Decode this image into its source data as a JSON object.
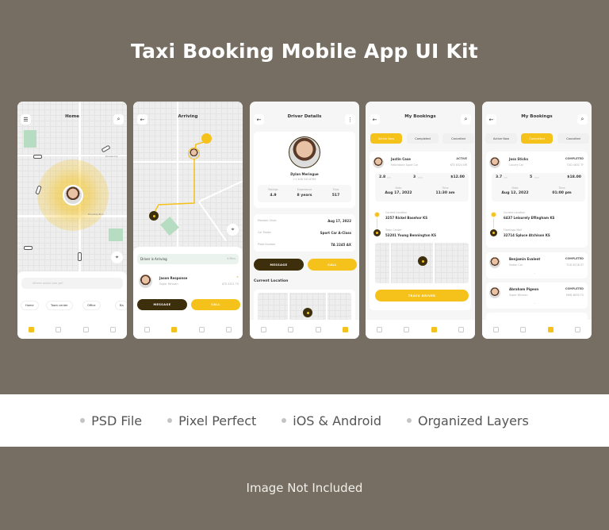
{
  "title": "Taxi Booking Mobile App UI Kit",
  "features": [
    "PSD File",
    "Pixel Perfect",
    "iOS & Android",
    "Organized Layers"
  ],
  "note": "Image Not Included",
  "colors": {
    "background": "#766e63",
    "accent": "#f5c21b",
    "dark": "#3d2e0c"
  },
  "home": {
    "title": "Home",
    "search_placeholder": "Where would you go?",
    "chips": [
      "Home",
      "Town center",
      "Office",
      "Ba"
    ],
    "street1": "Excellent Dr",
    "street2": "Broadway Blvd",
    "nav_active": 0
  },
  "arriving": {
    "title": "Arriving",
    "status": "Driver is Arriving",
    "eta": "4 Mins",
    "driver": {
      "name": "Jason Response",
      "car": "Super Minivan",
      "plate": "ATX 4321 TX"
    },
    "message": "MESSAGE",
    "call": "CALL",
    "nav_active": 1
  },
  "driver": {
    "title": "Driver Details",
    "name": "Dylan Meringue",
    "phone": "+1 408 345 6789",
    "stats": [
      {
        "label": "Ratings",
        "value": "4.9"
      },
      {
        "label": "Experience",
        "value": "8 years"
      },
      {
        "label": "Trips",
        "value": "517"
      }
    ],
    "info": [
      {
        "label": "Member Since",
        "value": "Aug 17, 2022"
      },
      {
        "label": "Car Model",
        "value": "Sport Car A-Class"
      },
      {
        "label": "Plate Number",
        "value": "TA 2245 AX"
      }
    ],
    "message": "MESSAGE",
    "call": "CALL",
    "location_title": "Current Location",
    "nav_active": 3
  },
  "bookings_active": {
    "title": "My Bookings",
    "tabs": [
      "Active Now",
      "Completed",
      "Cancelled"
    ],
    "active_tab": 0,
    "booking": {
      "name": "Justin Case",
      "car": "Hatchback Sport Car",
      "status": "ACTIVE",
      "plate": "KTE 8324 NR",
      "distance": "2.8",
      "distance_unit": "km",
      "duration": "3",
      "duration_unit": "min",
      "price": "$12.00",
      "date_label": "Date",
      "date": "Aug 17, 2022",
      "time_label": "Time",
      "time": "11:30 am",
      "from_label": "Current Location",
      "from": "3257 Rickel Basehor KS",
      "to_label": "Town Center",
      "to": "53201 Young Bennington KS"
    },
    "track": "TRACK DRIVER",
    "nav_active": 2
  },
  "bookings_completed": {
    "title": "My Bookings",
    "tabs": [
      "Active Now",
      "Completed",
      "Cancelled"
    ],
    "active_tab": 1,
    "booking": {
      "name": "Joss Sticks",
      "car": "Luxury Car",
      "status": "COMPLETED",
      "plate": "TXD 4631 TF",
      "distance": "3.7",
      "distance_unit": "km",
      "duration": "5",
      "duration_unit": "min",
      "price": "$18.00",
      "date_label": "Date",
      "date": "Aug 12, 2022",
      "time_label": "Time",
      "time": "01:00 pm",
      "from_label": "Current Location",
      "from": "6437 Leisurely Effingham KS",
      "to_label": "Flamingo Mall",
      "to": "32714 Spluce Atchison KS"
    },
    "others": [
      {
        "name": "Benjamin Evalent",
        "car": "Sedan Car",
        "status": "COMPLETED",
        "plate": "TGD 6726 ST"
      },
      {
        "name": "Abraham Pigeon",
        "car": "Super Minivan",
        "status": "COMPLETED",
        "plate": "MHB 6835 TS"
      }
    ],
    "nav_active": 2
  }
}
